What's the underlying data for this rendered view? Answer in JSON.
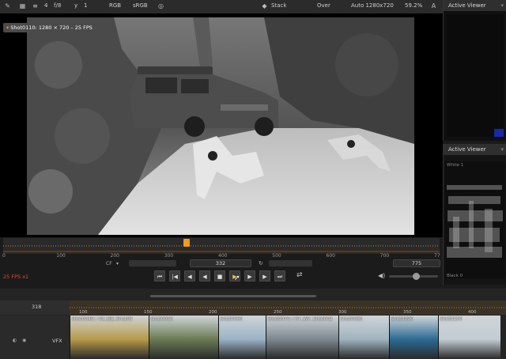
{
  "toolbar": {
    "frame_value": "4",
    "ratio": "f/8",
    "y_label": "y",
    "y_value": "1",
    "channels": "RGB",
    "colorspace": "sRGB",
    "stack": "Stack",
    "over": "Over",
    "format": "Auto 1280x720",
    "zoom": "59.2%"
  },
  "viewer": {
    "shot_label": "Shot0110: 1280 × 720 – 25 FPS"
  },
  "right_panel_top": {
    "title": "Active Viewer"
  },
  "right_panel_bottom": {
    "title": "Active Viewer",
    "white_label": "White 1",
    "black_label": "Black 0"
  },
  "timeline": {
    "ticks": [
      "0",
      "100",
      "200",
      "300",
      "400",
      "500",
      "600",
      "700",
      "77"
    ],
    "playhead_fraction": 0.42,
    "cf_label": "CF",
    "current_frame": "332",
    "end_frame": "775",
    "fps_text": "25 FPS x1",
    "volume_level": 0.55
  },
  "lower": {
    "frame_field": "318",
    "ruler_ticks": [
      "100",
      "150",
      "200",
      "250",
      "300",
      "350",
      "400"
    ],
    "track_label": "VFX",
    "clips": [
      {
        "label": "Shot0040 / 04_BB_Shot05",
        "color": "#b59a4a"
      },
      {
        "label": "Shot0050",
        "color": "#6a7a52"
      },
      {
        "label": "Shot0060",
        "color": "#9ab2c6"
      },
      {
        "label": "Shot0070 / 07_WF_Shot002",
        "color": "#7d8790"
      },
      {
        "label": "Shot0080",
        "color": "#a0b3bf"
      },
      {
        "label": "Shot0090",
        "color": "#2b6a93"
      },
      {
        "label": "Shot0100",
        "color": "#c2ccd2"
      }
    ]
  },
  "colors": {
    "accent": "#f39a1e",
    "fps_red": "#e24a2c"
  }
}
